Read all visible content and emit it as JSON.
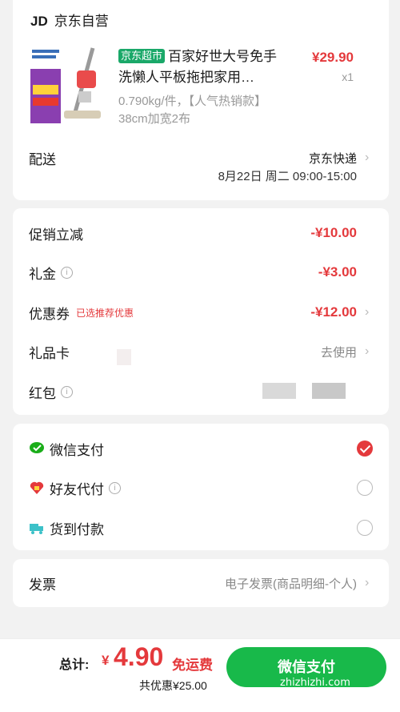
{
  "store": {
    "logo": "JD",
    "name": "京东自营"
  },
  "product": {
    "tag": "京东超市",
    "title": "百家好世大号免手洗懒人平板拖把家用…",
    "price": "¥29.90",
    "qty": "x1",
    "spec_line1": "0.790kg/件，【人气热销款】",
    "spec_line2": "38cm加宽2布"
  },
  "delivery": {
    "label": "配送",
    "method": "京东快递",
    "time": "8月22日 周二 09:00-15:00"
  },
  "promo": {
    "instant_label": "促销立减",
    "instant_value": "-¥10.00",
    "gift_money_label": "礼金",
    "gift_money_value": "-¥3.00",
    "coupon_label": "优惠券",
    "coupon_tag": "已选推荐优惠",
    "coupon_value": "-¥12.00",
    "gift_card_label": "礼品卡",
    "gift_card_action": "去使用",
    "red_packet_label": "红包"
  },
  "payment": {
    "options": [
      {
        "label": "微信支付",
        "icon": "wechat-pay-icon",
        "selected": true
      },
      {
        "label": "好友代付",
        "icon": "friend-pay-icon",
        "selected": false
      },
      {
        "label": "货到付款",
        "icon": "cash-on-delivery-icon",
        "selected": false
      }
    ]
  },
  "invoice": {
    "label": "发票",
    "value": "电子发票(商品明细-个人)"
  },
  "footer": {
    "total_label": "总计:",
    "currency": "¥",
    "total_value": "4.90",
    "free_shipping": "免运费",
    "saved": "共优惠¥25.00",
    "submit_label": "微信支付",
    "watermark": "zhizhizhi.com"
  },
  "colors": {
    "accent_red": "#e4393c",
    "pay_green": "#18b94a",
    "tag_green": "#1aa869"
  }
}
